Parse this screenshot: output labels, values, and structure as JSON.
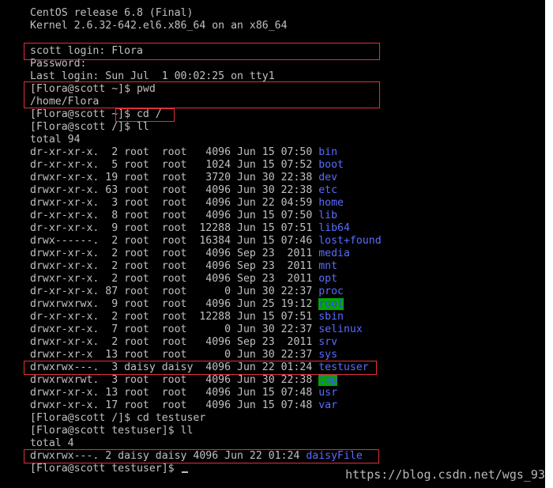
{
  "terminal": {
    "header": {
      "release": "CentOS release 6.8 (Final)",
      "kernel": "Kernel 2.6.32-642.el6.x86_64 on an x86_64"
    },
    "login": {
      "prompt": "scott login: Flora",
      "password": "Password:",
      "last_login": "Last login: Sun Jul  1 00:02:25 on tty1"
    },
    "commands": {
      "pwd_cmd": "[Flora@scott ~]$ pwd",
      "pwd_out": "/home/Flora",
      "cd_root_cmd": "[Flora@scott ~]$ cd /",
      "ll_cmd": "[Flora@scott /]$ ll",
      "total_root": "total 94",
      "cd_testuser_cmd": "[Flora@scott /]$ cd testuser",
      "ll_testuser_cmd": "[Flora@scott testuser]$ ll",
      "total_testuser": "total 4",
      "final_prompt": "[Flora@scott testuser]$ "
    },
    "root_listing": [
      {
        "meta": "dr-xr-xr-x.  2 root  root   4096 Jun 15 07:50 ",
        "name": "bin"
      },
      {
        "meta": "dr-xr-xr-x.  5 root  root   1024 Jun 15 07:52 ",
        "name": "boot"
      },
      {
        "meta": "drwxr-xr-x. 19 root  root   3720 Jun 30 22:38 ",
        "name": "dev"
      },
      {
        "meta": "drwxr-xr-x. 63 root  root   4096 Jun 30 22:38 ",
        "name": "etc"
      },
      {
        "meta": "drwxr-xr-x.  3 root  root   4096 Jun 22 04:59 ",
        "name": "home"
      },
      {
        "meta": "dr-xr-xr-x.  8 root  root   4096 Jun 15 07:50 ",
        "name": "lib"
      },
      {
        "meta": "dr-xr-xr-x.  9 root  root  12288 Jun 15 07:51 ",
        "name": "lib64"
      },
      {
        "meta": "drwx------.  2 root  root  16384 Jun 15 07:46 ",
        "name": "lost+found"
      },
      {
        "meta": "drwxr-xr-x.  2 root  root   4096 Sep 23  2011 ",
        "name": "media"
      },
      {
        "meta": "drwxr-xr-x.  2 root  root   4096 Sep 23  2011 ",
        "name": "mnt"
      },
      {
        "meta": "drwxr-xr-x.  2 root  root   4096 Sep 23  2011 ",
        "name": "opt"
      },
      {
        "meta": "dr-xr-xr-x. 87 root  root      0 Jun 30 22:37 ",
        "name": "proc"
      },
      {
        "meta": "drwxrwxrwx.  9 root  root   4096 Jun 25 19:12 ",
        "name": "root"
      },
      {
        "meta": "dr-xr-xr-x.  2 root  root  12288 Jun 15 07:51 ",
        "name": "sbin"
      },
      {
        "meta": "drwxr-xr-x.  7 root  root      0 Jun 30 22:37 ",
        "name": "selinux"
      },
      {
        "meta": "drwxr-xr-x.  2 root  root   4096 Sep 23  2011 ",
        "name": "srv"
      },
      {
        "meta": "drwxr-xr-x  13 root  root      0 Jun 30 22:37 ",
        "name": "sys"
      },
      {
        "meta": "drwxrwx---.  3 daisy daisy  4096 Jun 22 01:24 ",
        "name": "testuser"
      },
      {
        "meta": "drwxrwxrwt.  3 root  root   4096 Jun 30 22:38 ",
        "name": "tmp"
      },
      {
        "meta": "drwxr-xr-x. 13 root  root   4096 Jun 15 07:48 ",
        "name": "usr"
      },
      {
        "meta": "drwxr-xr-x. 17 root  root   4096 Jun 15 07:48 ",
        "name": "var"
      }
    ],
    "testuser_listing": [
      {
        "meta": "drwxrwx---. 2 daisy daisy 4096 Jun 22 01:24 ",
        "name": "daisyFile"
      }
    ],
    "colors": {
      "background": "#000000",
      "text": "#c0c0c0",
      "directory": "#5a6cff",
      "highlight_bg": "#00a800",
      "annotation_box": "#e0303a"
    }
  },
  "watermark": "https://blog.csdn.net/wgs_93"
}
